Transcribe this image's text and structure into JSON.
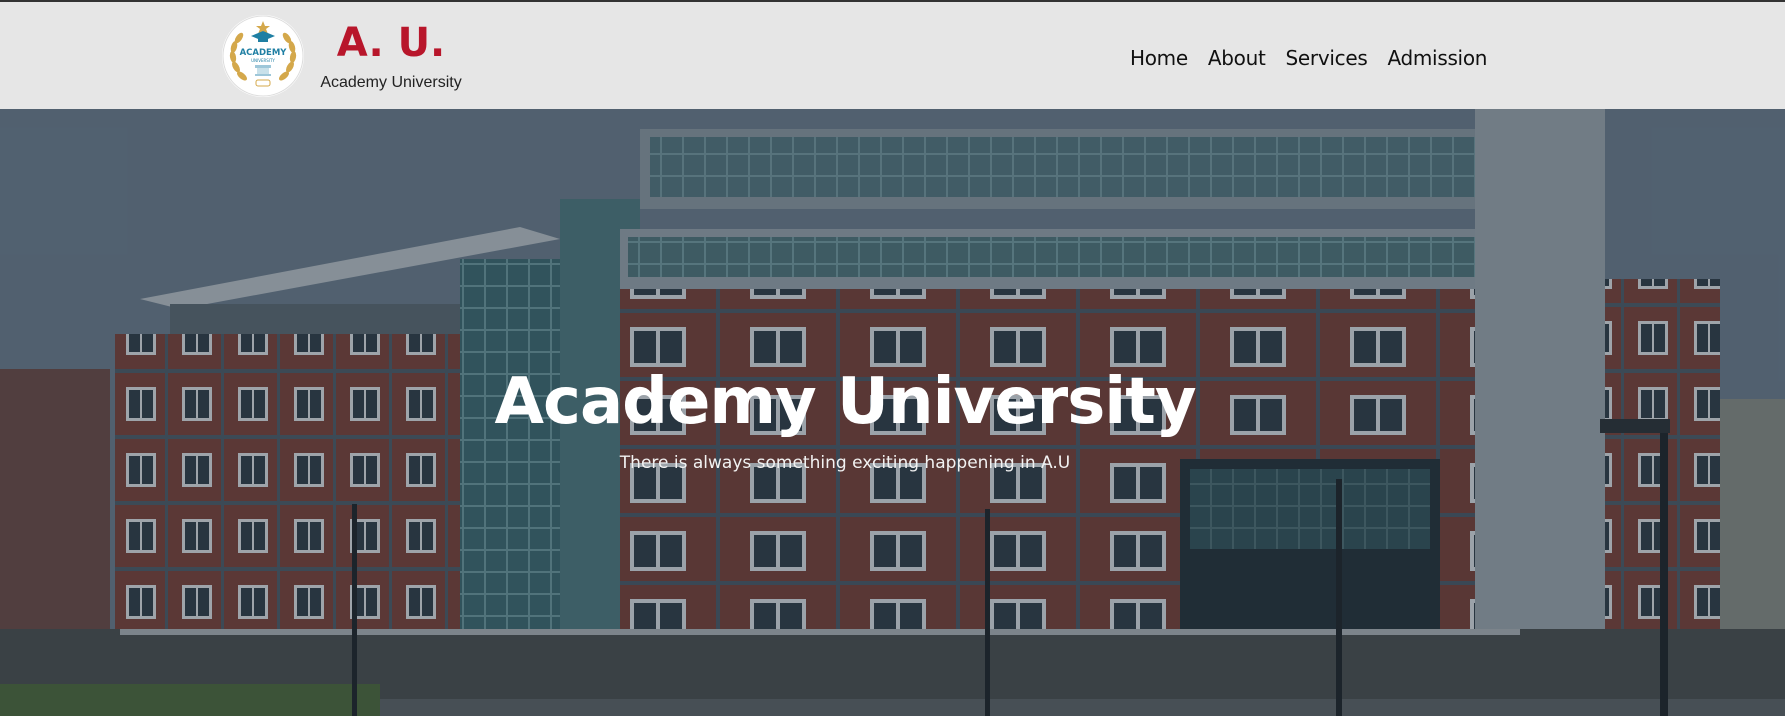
{
  "brand": {
    "abbr": "A. U.",
    "name": "Academy University",
    "logo_text": "ACADEMY",
    "logo_subtext": "UNIVERSITY",
    "colors": {
      "abbr": "#b8162b",
      "navbar_bg": "#e6e6e6",
      "logo_gold": "#d4a84b",
      "logo_teal": "#1f7fa3"
    }
  },
  "nav": {
    "items": [
      {
        "label": "Home"
      },
      {
        "label": "About"
      },
      {
        "label": "Services"
      },
      {
        "label": "Admission"
      }
    ]
  },
  "hero": {
    "title": "Academy University",
    "subtitle": "There is always something exciting happening in A.U",
    "background": "university-building-photo"
  }
}
